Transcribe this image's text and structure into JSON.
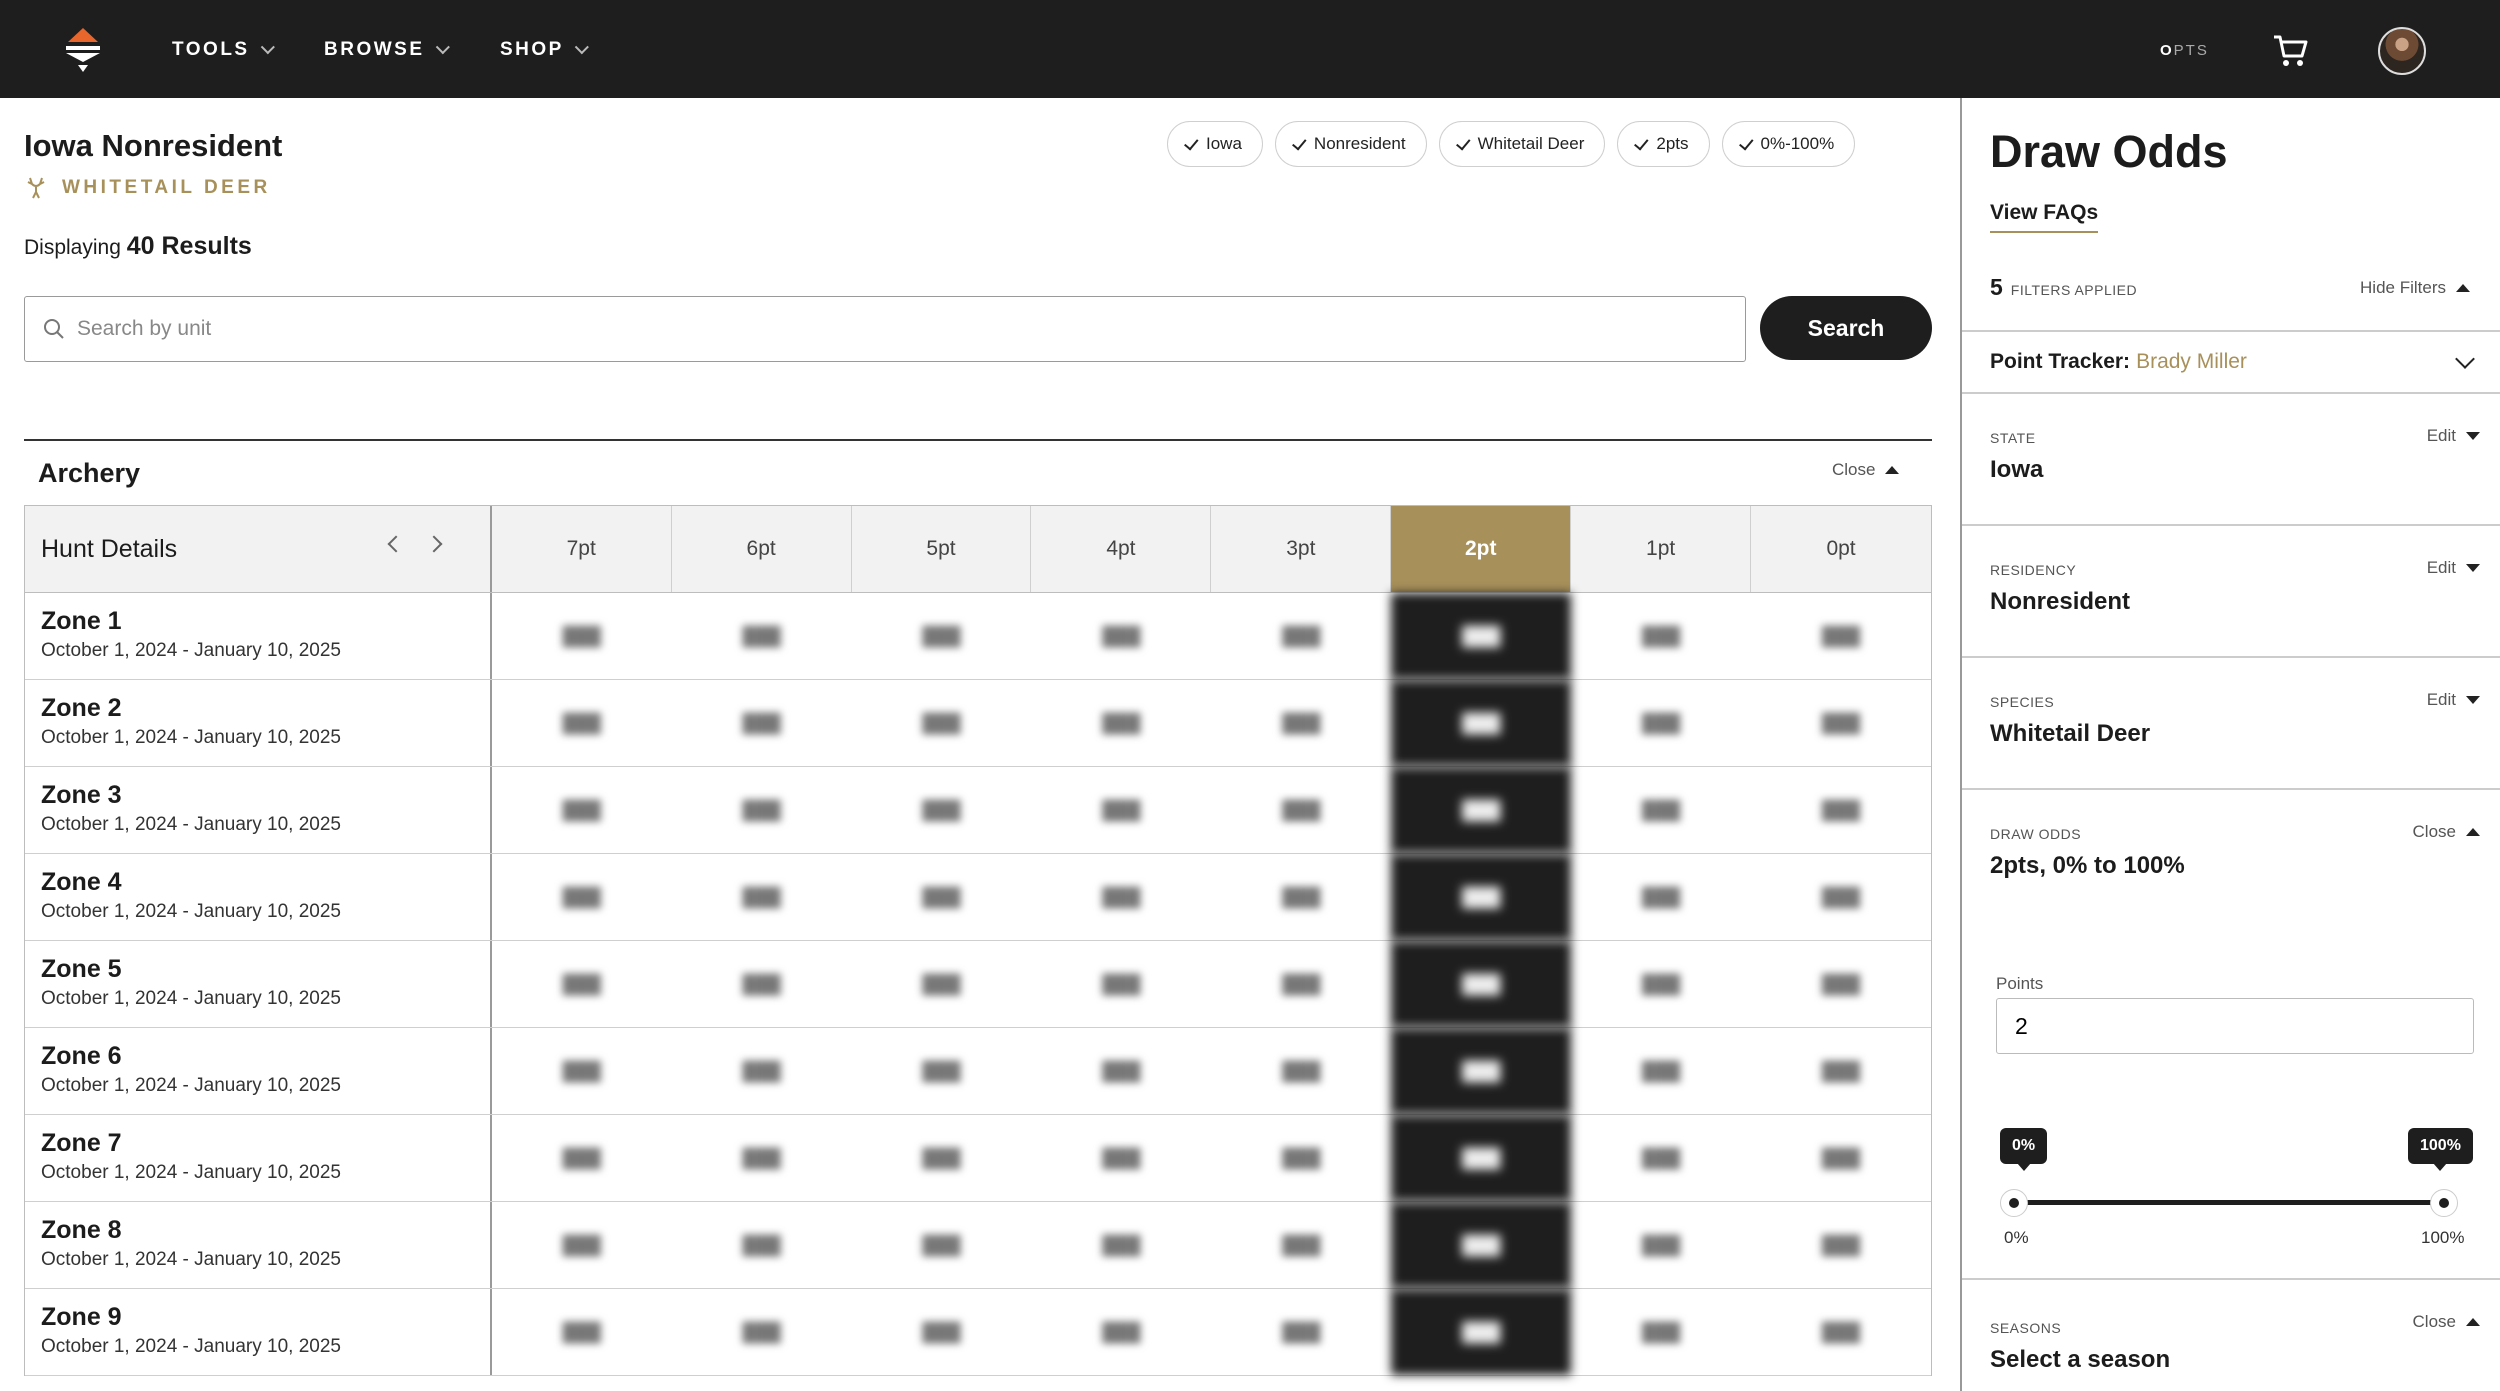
{
  "nav": {
    "items": [
      "TOOLS",
      "BROWSE",
      "SHOP"
    ],
    "points_o": "O",
    "points_suffix": "PTS"
  },
  "page": {
    "title": "Iowa Nonresident",
    "species": "WHITETAIL DEER",
    "results_prefix": "Displaying",
    "results_count": "40 Results"
  },
  "chips": [
    "Iowa",
    "Nonresident",
    "Whitetail Deer",
    "2pts",
    "0%-100%"
  ],
  "search": {
    "placeholder": "Search by unit",
    "button": "Search"
  },
  "section": {
    "title": "Archery",
    "close": "Close"
  },
  "table": {
    "hunt_header": "Hunt Details",
    "point_columns": [
      "7pt",
      "6pt",
      "5pt",
      "4pt",
      "3pt",
      "2pt",
      "1pt",
      "0pt"
    ],
    "active_column": "2pt",
    "rows": [
      {
        "zone": "Zone 1",
        "dates": "October 1, 2024 - January 10, 2025"
      },
      {
        "zone": "Zone 2",
        "dates": "October 1, 2024 - January 10, 2025"
      },
      {
        "zone": "Zone 3",
        "dates": "October 1, 2024 - January 10, 2025"
      },
      {
        "zone": "Zone 4",
        "dates": "October 1, 2024 - January 10, 2025"
      },
      {
        "zone": "Zone 5",
        "dates": "October 1, 2024 - January 10, 2025"
      },
      {
        "zone": "Zone 6",
        "dates": "October 1, 2024 - January 10, 2025"
      },
      {
        "zone": "Zone 7",
        "dates": "October 1, 2024 - January 10, 2025"
      },
      {
        "zone": "Zone 8",
        "dates": "October 1, 2024 - January 10, 2025"
      },
      {
        "zone": "Zone 9",
        "dates": "October 1, 2024 - January 10, 2025"
      }
    ]
  },
  "panel": {
    "title": "Draw Odds",
    "faq": "View FAQs",
    "filters_count": "5",
    "filters_label": "FILTERS APPLIED",
    "hide_filters": "Hide Filters",
    "tracker_label": "Point Tracker:",
    "tracker_name": "Brady Miller",
    "filters": [
      {
        "label": "STATE",
        "value": "Iowa",
        "action": "Edit"
      },
      {
        "label": "RESIDENCY",
        "value": "Nonresident",
        "action": "Edit"
      },
      {
        "label": "SPECIES",
        "value": "Whitetail Deer",
        "action": "Edit"
      },
      {
        "label": "DRAW ODDS",
        "value": "2pts, 0% to 100%",
        "action": "Close"
      },
      {
        "label": "SEASONS",
        "value": "Select a season",
        "action": "Close"
      }
    ],
    "points_label": "Points",
    "points_value": "2",
    "range_min": "0%",
    "range_max": "100%",
    "range_low_fraction": 0,
    "range_high_fraction": 1
  },
  "colors": {
    "accent_gold": "#a8905a",
    "nav_bg": "#1e1e1e",
    "logo_orange": "#e8652b"
  }
}
